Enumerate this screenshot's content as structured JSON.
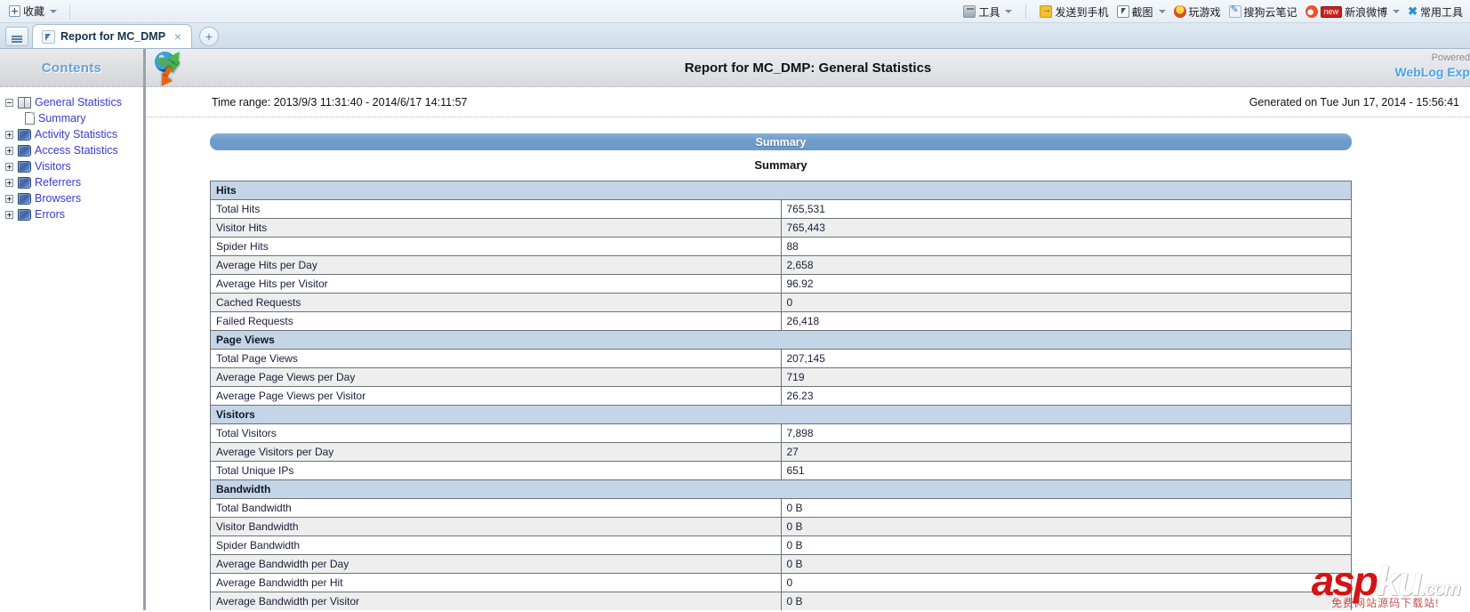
{
  "browser": {
    "favorites_bar": {
      "add_favorite_label": "收藏",
      "toolbar_items": [
        {
          "icon": "tools-icon",
          "label": "工具",
          "has_caret": true,
          "badge": ""
        },
        {
          "icon": "send-phone-icon",
          "label": "发送到手机",
          "has_caret": false,
          "badge": ""
        },
        {
          "icon": "screenshot-icon",
          "label": "截图",
          "has_caret": true,
          "badge": ""
        },
        {
          "icon": "game-icon",
          "label": "玩游戏",
          "has_caret": false,
          "badge": ""
        },
        {
          "icon": "note-icon",
          "label": "搜狗云笔记",
          "has_caret": false,
          "badge": ""
        },
        {
          "icon": "weibo-icon",
          "label": "新浪微博",
          "has_caret": true,
          "badge": "new"
        },
        {
          "icon": "common-tools-icon",
          "label": "常用工具",
          "has_caret": false,
          "badge": ""
        }
      ]
    },
    "tab": {
      "title": "Report for MC_DMP",
      "close_label": "×",
      "new_tab_label": "+"
    }
  },
  "sidebar": {
    "title": "Contents",
    "items": [
      {
        "label": "General Statistics",
        "icon": "open-book-icon",
        "expander": "minus",
        "indent": 0
      },
      {
        "label": "Summary",
        "icon": "page-icon",
        "expander": "none",
        "indent": 1
      },
      {
        "label": "Activity Statistics",
        "icon": "closed-book-icon",
        "expander": "plus",
        "indent": 0
      },
      {
        "label": "Access Statistics",
        "icon": "closed-book-icon",
        "expander": "plus",
        "indent": 0
      },
      {
        "label": "Visitors",
        "icon": "closed-book-icon",
        "expander": "plus",
        "indent": 0
      },
      {
        "label": "Referrers",
        "icon": "closed-book-icon",
        "expander": "plus",
        "indent": 0
      },
      {
        "label": "Browsers",
        "icon": "closed-book-icon",
        "expander": "plus",
        "indent": 0
      },
      {
        "label": "Errors",
        "icon": "closed-book-icon",
        "expander": "plus",
        "indent": 0
      }
    ]
  },
  "report": {
    "title": "Report for MC_DMP: General Statistics",
    "powered_line1": "Powered",
    "powered_line2": "WebLog Exp",
    "time_range": "Time range: 2013/9/3 11:31:40 - 2014/6/17 14:11:57",
    "generated_on": "Generated on Tue Jun 17, 2014 - 15:56:41",
    "section_banner": "Summary",
    "section_subtitle": "Summary",
    "table": {
      "rows": [
        {
          "type": "group",
          "label": "Hits",
          "value": ""
        },
        {
          "type": "row",
          "label": "Total Hits",
          "value": "765,531"
        },
        {
          "type": "row",
          "label": "Visitor Hits",
          "value": "765,443"
        },
        {
          "type": "row",
          "label": "Spider Hits",
          "value": "88"
        },
        {
          "type": "row",
          "label": "Average Hits per Day",
          "value": "2,658"
        },
        {
          "type": "row",
          "label": "Average Hits per Visitor",
          "value": "96.92"
        },
        {
          "type": "row",
          "label": "Cached Requests",
          "value": "0"
        },
        {
          "type": "row",
          "label": "Failed Requests",
          "value": "26,418"
        },
        {
          "type": "group",
          "label": "Page Views",
          "value": ""
        },
        {
          "type": "row",
          "label": "Total Page Views",
          "value": "207,145"
        },
        {
          "type": "row",
          "label": "Average Page Views per Day",
          "value": "719"
        },
        {
          "type": "row",
          "label": "Average Page Views per Visitor",
          "value": "26.23"
        },
        {
          "type": "group",
          "label": "Visitors",
          "value": ""
        },
        {
          "type": "row",
          "label": "Total Visitors",
          "value": "7,898"
        },
        {
          "type": "row",
          "label": "Average Visitors per Day",
          "value": "27"
        },
        {
          "type": "row",
          "label": "Total Unique IPs",
          "value": "651"
        },
        {
          "type": "group",
          "label": "Bandwidth",
          "value": ""
        },
        {
          "type": "row",
          "label": "Total Bandwidth",
          "value": "0 B"
        },
        {
          "type": "row",
          "label": "Visitor Bandwidth",
          "value": "0 B"
        },
        {
          "type": "row",
          "label": "Spider Bandwidth",
          "value": "0 B"
        },
        {
          "type": "row",
          "label": "Average Bandwidth per Day",
          "value": "0 B"
        },
        {
          "type": "row",
          "label": "Average Bandwidth per Hit",
          "value": "0"
        },
        {
          "type": "row",
          "label": "Average Bandwidth per Visitor",
          "value": "0 B"
        }
      ]
    }
  },
  "watermark": {
    "part1": "asp",
    "part2": "ku",
    "part3": ".com",
    "subtitle": "免费网站源码下载站!"
  },
  "colors": {
    "banner_blue": "#6d9ccb",
    "group_row": "#c5d5e8",
    "tree_link": "#3a3ad0",
    "contents_title": "#6aa2d2",
    "watermark_red": "#d41414"
  }
}
